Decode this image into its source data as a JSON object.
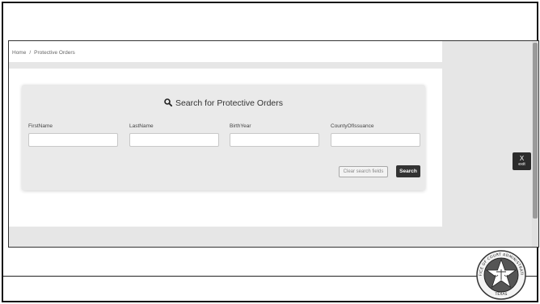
{
  "breadcrumb": {
    "home": "Home",
    "separator": "/",
    "current": "Protective Orders"
  },
  "search_card": {
    "title": "Search for Protective Orders",
    "fields": [
      {
        "label": "FirstName",
        "value": ""
      },
      {
        "label": "LastName",
        "value": ""
      },
      {
        "label": "BirthYear",
        "value": ""
      },
      {
        "label": "CountyOfIssuance",
        "value": ""
      }
    ],
    "clear_label": "Clear search fields",
    "search_label": "Search"
  },
  "exit_button": {
    "symbol": "X",
    "label": "exit"
  },
  "seal": {
    "ring_text": "OFFICE OF COURT ADMINISTRATION",
    "state": "TEXAS"
  },
  "colors": {
    "button_dark": "#333333",
    "card_bg": "#eaeaea",
    "embed_bg": "#e6e6e6"
  }
}
